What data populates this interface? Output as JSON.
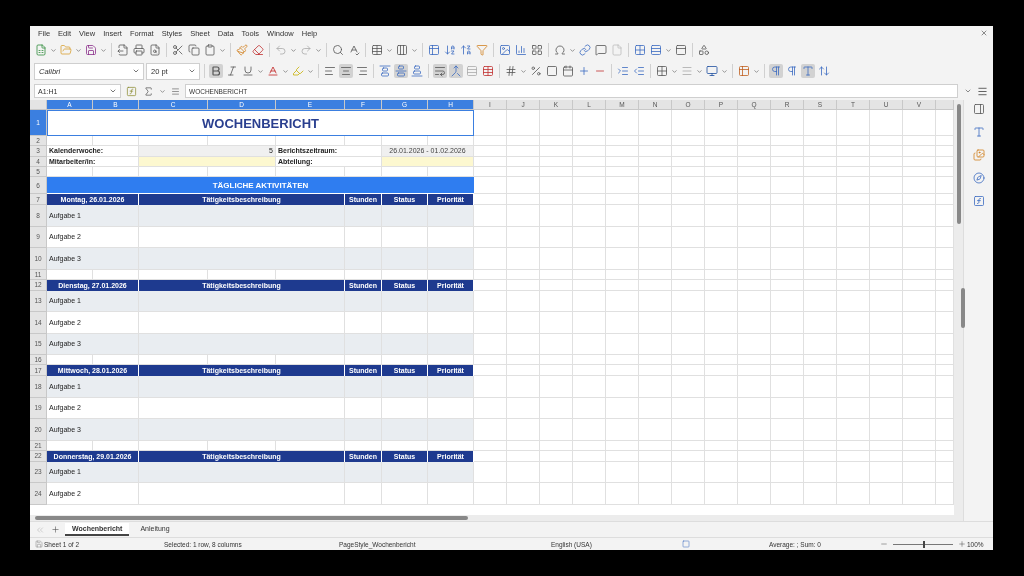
{
  "menu": [
    "File",
    "Edit",
    "View",
    "Insert",
    "Format",
    "Styles",
    "Sheet",
    "Data",
    "Tools",
    "Window",
    "Help"
  ],
  "formatting": {
    "font_name": "Calibri",
    "font_size": "20 pt",
    "bold": true,
    "align_center": true
  },
  "formula_bar": {
    "name_box": "A1:H1",
    "content": "WOCHENBERICHT"
  },
  "columns": [
    {
      "label": "A",
      "selected": true
    },
    {
      "label": "B",
      "selected": true
    },
    {
      "label": "C",
      "selected": true
    },
    {
      "label": "D",
      "selected": true
    },
    {
      "label": "E",
      "selected": true
    },
    {
      "label": "F",
      "selected": true
    },
    {
      "label": "G",
      "selected": true
    },
    {
      "label": "H",
      "selected": true
    },
    {
      "label": "I",
      "selected": false
    },
    {
      "label": "J",
      "selected": false
    },
    {
      "label": "K",
      "selected": false
    },
    {
      "label": "L",
      "selected": false
    },
    {
      "label": "M",
      "selected": false
    },
    {
      "label": "N",
      "selected": false
    },
    {
      "label": "O",
      "selected": false
    },
    {
      "label": "P",
      "selected": false
    },
    {
      "label": "Q",
      "selected": false
    },
    {
      "label": "R",
      "selected": false
    },
    {
      "label": "S",
      "selected": false
    },
    {
      "label": "T",
      "selected": false
    },
    {
      "label": "U",
      "selected": false
    },
    {
      "label": "V",
      "selected": false
    }
  ],
  "rows": [
    {
      "number": "1",
      "selected": true,
      "kind": "title",
      "text": "WOCHENBERICHT"
    },
    {
      "number": "2",
      "selected": false,
      "kind": "blank"
    },
    {
      "number": "3",
      "selected": false,
      "kind": "info",
      "highlight": false,
      "label_1": "Kalenderwoche:",
      "value_1": "5",
      "label_2": "Berichtszeitraum:",
      "value_2": "26.01.2026 - 01.02.2026"
    },
    {
      "number": "4",
      "selected": false,
      "kind": "info",
      "highlight": true,
      "label_1": "Mitarbeiter/in:",
      "label_2": "Abteilung:"
    },
    {
      "number": "5",
      "selected": false,
      "kind": "blank"
    },
    {
      "number": "6",
      "selected": false,
      "kind": "section",
      "text": "TÄGLICHE AKTIVITÄTEN"
    },
    {
      "number": "7",
      "selected": false,
      "kind": "day_header",
      "cells": [
        "Montag, 26.01.2026",
        "Tätigkeitsbeschreibung",
        "Stunden",
        "Status",
        "Priorität"
      ]
    },
    {
      "number": "8",
      "selected": false,
      "kind": "task",
      "shaded": true,
      "text": "Aufgabe 1"
    },
    {
      "number": "9",
      "selected": false,
      "kind": "task",
      "shaded": false,
      "text": "Aufgabe 2"
    },
    {
      "number": "10",
      "selected": false,
      "kind": "task",
      "shaded": true,
      "text": "Aufgabe 3"
    },
    {
      "number": "11",
      "selected": false,
      "kind": "blank"
    },
    {
      "number": "12",
      "selected": false,
      "kind": "day_header",
      "cells": [
        "Dienstag, 27.01.2026",
        "Tätigkeitsbeschreibung",
        "Stunden",
        "Status",
        "Priorität"
      ]
    },
    {
      "number": "13",
      "selected": false,
      "kind": "task",
      "shaded": true,
      "text": "Aufgabe 1"
    },
    {
      "number": "14",
      "selected": false,
      "kind": "task",
      "shaded": false,
      "text": "Aufgabe 2"
    },
    {
      "number": "15",
      "selected": false,
      "kind": "task",
      "shaded": true,
      "text": "Aufgabe 3"
    },
    {
      "number": "16",
      "selected": false,
      "kind": "blank"
    },
    {
      "number": "17",
      "selected": false,
      "kind": "day_header",
      "cells": [
        "Mittwoch, 28.01.2026",
        "Tätigkeitsbeschreibung",
        "Stunden",
        "Status",
        "Priorität"
      ]
    },
    {
      "number": "18",
      "selected": false,
      "kind": "task",
      "shaded": true,
      "text": "Aufgabe 1"
    },
    {
      "number": "19",
      "selected": false,
      "kind": "task",
      "shaded": false,
      "text": "Aufgabe 2"
    },
    {
      "number": "20",
      "selected": false,
      "kind": "task",
      "shaded": true,
      "text": "Aufgabe 3"
    },
    {
      "number": "21",
      "selected": false,
      "kind": "blank"
    },
    {
      "number": "22",
      "selected": false,
      "kind": "day_header",
      "cells": [
        "Donnerstag, 29.01.2026",
        "Tätigkeitsbeschreibung",
        "Stunden",
        "Status",
        "Priorität"
      ]
    },
    {
      "number": "23",
      "selected": false,
      "kind": "task",
      "shaded": true,
      "text": "Aufgabe 1"
    },
    {
      "number": "24",
      "selected": false,
      "kind": "task",
      "shaded": false,
      "text": "Aufgabe 2"
    }
  ],
  "sheet_tabs": [
    {
      "label": "Wochenbericht",
      "selected": true
    },
    {
      "label": "Anleitung",
      "selected": false
    }
  ],
  "status_bar": {
    "sheet": "Sheet 1 of 2",
    "selection": "Selected: 1 row, 8 columns",
    "page_style": "PageStyle_Wochenbericht",
    "language": "English (USA)",
    "sum": "Average: ; Sum: 0",
    "zoom_slider": {
      "level": 0.5
    },
    "zoom": "100%"
  }
}
